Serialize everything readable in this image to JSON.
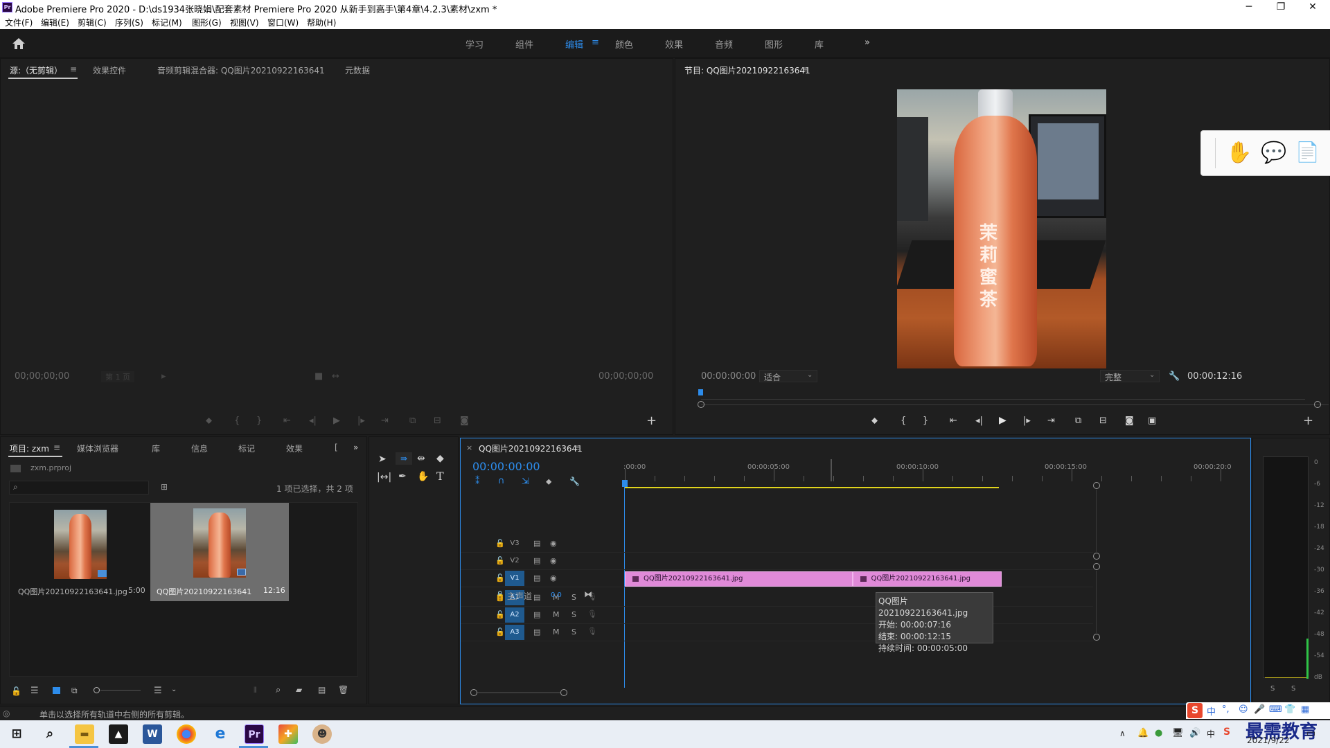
{
  "titlebar": {
    "app_icon": "Pr",
    "title": "Adobe Premiere Pro 2020 - D:\\ds1934张晓娟\\配套素材 Premiere Pro 2020 从新手到高手\\第4章\\4.2.3\\素材\\zxm *",
    "minimize": "─",
    "restore": "❐",
    "close": "✕"
  },
  "menu": [
    "文件(F)",
    "编辑(E)",
    "剪辑(C)",
    "序列(S)",
    "标记(M)",
    "图形(G)",
    "视图(V)",
    "窗口(W)",
    "帮助(H)"
  ],
  "workspaces": {
    "items": [
      "学习",
      "组件",
      "编辑",
      "颜色",
      "效果",
      "音频",
      "图形",
      "库"
    ],
    "active_index": 2,
    "more": "»"
  },
  "source_panel": {
    "tabs": [
      "源:（无剪辑）",
      "效果控件",
      "音频剪辑混合器: QQ图片20210922163641",
      "元数据"
    ],
    "menu_glyph": "≡",
    "timecode_left": "00;00;00;00",
    "page_select": "第 1 页",
    "timecode_right": "00;00;00;00"
  },
  "program_panel": {
    "title": "节目: QQ图片20210922163641",
    "menu_glyph": "≡",
    "timecode": "00:00:00:00",
    "fit": "适合",
    "quality": "完整",
    "duration": "00:00:12:16"
  },
  "project_panel": {
    "tabs": [
      "项目: zxm",
      "媒体浏览器",
      "库",
      "信息",
      "标记",
      "效果",
      "["
    ],
    "menu_glyph": "≡",
    "more": "»",
    "project_file": "zxm.prproj",
    "search_placeholder": "",
    "selection_info": "1 项已选择，共 2 项",
    "items": [
      {
        "name": "QQ图片20210922163641.jpg",
        "duration": "5:00"
      },
      {
        "name": "QQ图片20210922163641",
        "duration": "12:16"
      }
    ]
  },
  "timeline": {
    "close": "×",
    "title": "QQ图片20210922163641",
    "menu_glyph": "≡",
    "timecode": "00:00:00:00",
    "ruler": [
      ":00:00",
      "00:00:05:00",
      "00:00:10:00",
      "00:00:15:00",
      "00:00:20:0"
    ],
    "video_tracks": [
      "V3",
      "V2",
      "V1"
    ],
    "audio_tracks": [
      "A1",
      "A2",
      "A3"
    ],
    "mute": "M",
    "solo": "S",
    "master_label": "主声道",
    "master_value": "0.0",
    "clips": [
      {
        "label": "QQ图片20210922163641.jpg",
        "start_s": 0,
        "end_s": 7.64
      },
      {
        "label": "QQ图片20210922163641.jpg",
        "start_s": 7.64,
        "end_s": 12.64
      }
    ],
    "tooltip": {
      "name": "QQ图片20210922163641.jpg",
      "start": "开始: 00:00:07:16",
      "end": "结束: 00:00:12:15",
      "duration": "持续时间: 00:00:05:00"
    }
  },
  "audio_meter": {
    "ticks": [
      "0",
      "-6",
      "-12",
      "-18",
      "-24",
      "-30",
      "-36",
      "-42",
      "-48",
      "-54",
      "dB"
    ],
    "solo_left": "S",
    "solo_right": "S"
  },
  "status_bar": {
    "text": "单击以选择所有轨道中右侧的所有剪辑。"
  },
  "taskbar": {
    "date": "2021/9/22",
    "watermark": "最需教育",
    "ime": "中"
  },
  "colors": {
    "accent": "#2d8ceb",
    "clip": "#e08ad8",
    "timeline_border": "#2d8ceb",
    "workarea": "#e0d41c"
  }
}
